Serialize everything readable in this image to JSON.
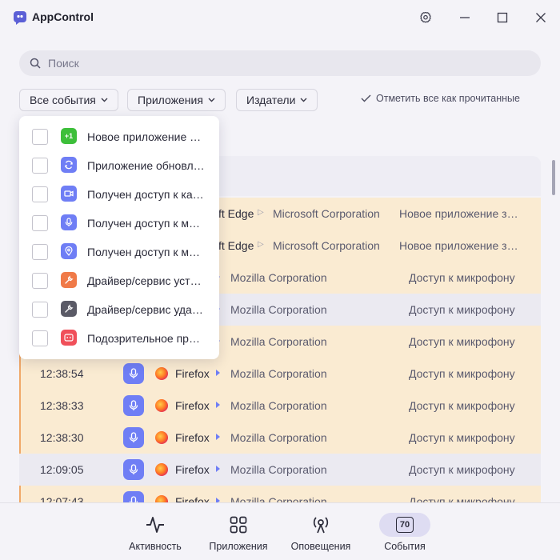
{
  "app": {
    "title": "AppControl"
  },
  "search": {
    "placeholder": "Поиск"
  },
  "filters": {
    "all_events": "Все события",
    "apps": "Приложения",
    "publishers": "Издатели",
    "mark_all_read": "Отметить все как прочитанные"
  },
  "dropdown": {
    "items": [
      {
        "label": "Новое приложение …",
        "icon": "plus-one-icon",
        "color": "#3dbf3a",
        "checked": false
      },
      {
        "label": "Приложение обновл…",
        "icon": "refresh-icon",
        "color": "#6f7ef5",
        "checked": false
      },
      {
        "label": "Получен доступ к ка…",
        "icon": "camera-icon",
        "color": "#6f7ef5",
        "checked": false
      },
      {
        "label": "Получен доступ к м…",
        "icon": "microphone-icon",
        "color": "#6f7ef5",
        "checked": false
      },
      {
        "label": "Получен доступ к м…",
        "icon": "location-icon",
        "color": "#6f7ef5",
        "checked": false
      },
      {
        "label": "Драйвер/сервис уст…",
        "icon": "wrench-icon",
        "color": "#f07a48",
        "checked": false
      },
      {
        "label": "Драйвер/сервис уда…",
        "icon": "wrench-icon",
        "color": "#5a5a66",
        "checked": false
      },
      {
        "label": "Подозрительное пр…",
        "icon": "suspicious-icon",
        "color": "#f0505a",
        "checked": false
      }
    ]
  },
  "events": [
    {
      "time": "",
      "app": "ft Edge",
      "publisher": "Microsoft Corporation",
      "event": "Новое приложение з…",
      "state": "unread"
    },
    {
      "time": "",
      "app": "ft Edge",
      "publisher": "Microsoft Corporation",
      "event": "Новое приложение з…",
      "state": "unread"
    },
    {
      "time": "",
      "app": "",
      "publisher": "Mozilla Corporation",
      "event": "Доступ к микрофону",
      "state": "unread"
    },
    {
      "time": "",
      "app": "",
      "publisher": "Mozilla Corporation",
      "event": "Доступ к микрофону",
      "state": "read"
    },
    {
      "time": "",
      "app": "",
      "publisher": "Mozilla Corporation",
      "event": "Доступ к микрофону",
      "state": "unread"
    },
    {
      "time": "12:38:54",
      "app": "Firefox",
      "publisher": "Mozilla Corporation",
      "event": "Доступ к микрофону",
      "state": "unread"
    },
    {
      "time": "12:38:33",
      "app": "Firefox",
      "publisher": "Mozilla Corporation",
      "event": "Доступ к микрофону",
      "state": "unread"
    },
    {
      "time": "12:38:30",
      "app": "Firefox",
      "publisher": "Mozilla Corporation",
      "event": "Доступ к микрофону",
      "state": "unread"
    },
    {
      "time": "12:09:05",
      "app": "Firefox",
      "publisher": "Mozilla Corporation",
      "event": "Доступ к микрофону",
      "state": "read"
    },
    {
      "time": "12:07:43",
      "app": "Firefox",
      "publisher": "Mozilla Corporation",
      "event": "Доступ к микрофону",
      "state": "unread"
    }
  ],
  "nav": {
    "activity": "Активность",
    "apps": "Приложения",
    "alerts": "Оповещения",
    "events": "События",
    "events_badge": "70"
  },
  "colors": {
    "accent": "#6f7ef5",
    "unread_row": "#faebd2",
    "read_row": "#ebeaf1"
  }
}
